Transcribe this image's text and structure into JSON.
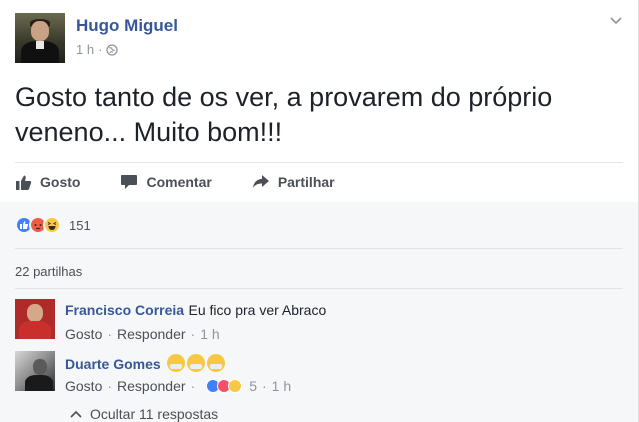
{
  "post": {
    "author": "Hugo Miguel",
    "time": "1 h",
    "privacy_icon": "globe-icon",
    "text": "Gosto tanto de os ver, a provarem do próprio veneno... Muito bom!!!"
  },
  "actions": {
    "like": "Gosto",
    "comment": "Comentar",
    "share": "Partilhar"
  },
  "reactions": {
    "types": [
      "like",
      "angry",
      "haha"
    ],
    "count": "151"
  },
  "shares": "22 partilhas",
  "comments": [
    {
      "name": "Francisco Correia",
      "text": "Eu fico pra ver Abraco",
      "like": "Gosto",
      "reply": "Responder",
      "time": "1 h"
    },
    {
      "name": "Duarte Gomes",
      "emojis": [
        "face-with-medical-mask",
        "face-with-medical-mask",
        "face-with-medical-mask"
      ],
      "like": "Gosto",
      "reply": "Responder",
      "reaction_count": "5",
      "time": "1 h"
    }
  ],
  "hide_replies": "Ocultar 11 respostas",
  "colors": {
    "link": "#365899",
    "text": "#1d2129",
    "secondary": "#90949c",
    "like_blue": "#4080ff",
    "haha_yellow": "#f7c844",
    "angry_red": "#f05d47"
  }
}
